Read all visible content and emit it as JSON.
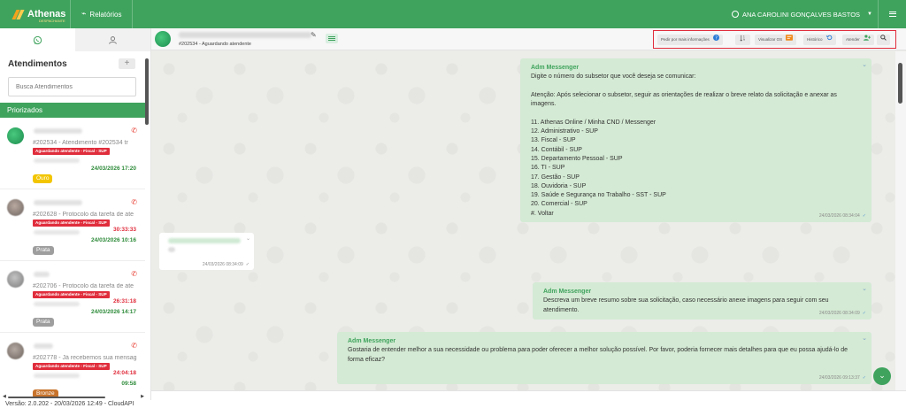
{
  "app": {
    "logo_text": "Athenas",
    "logo_sub": "DESPACHANTE",
    "nav_reports": "Relatórios",
    "user_name": "ANA CAROLINI GONÇALVES BASTOS",
    "colors": {
      "primary": "#3fa35d",
      "danger": "#e02d3c",
      "bubble": "#d4ead4"
    }
  },
  "sidebar": {
    "tabs": [
      {
        "icon": "whatsapp-icon"
      },
      {
        "icon": "user-icon"
      }
    ],
    "title": "Atendimentos",
    "add_label": "+",
    "search_placeholder": "Busca Atendimentos",
    "section_label": "Priorizados",
    "conversations": [
      {
        "subject": "#202534 - Atendimento #202534 tr",
        "badge": "Aguardando atendente - Fiscal - SUP",
        "timer": "",
        "date": "24/03/2026 17:20",
        "tier": "Ouro",
        "tier_color": "#f2c500",
        "avatar": "green"
      },
      {
        "subject": "#202628 - Protocolo da tarefa de ate",
        "badge": "Aguardando atendente - Fiscal - SUP",
        "timer": "30:33:33",
        "date": "24/03/2026 10:16",
        "tier": "Prata",
        "tier_color": "#9e9e9e",
        "avatar": "gray"
      },
      {
        "subject": "#202706 - Protocolo da tarefa de ate",
        "badge": "Aguardando atendente - Fiscal - SUP",
        "timer": "26:31:18",
        "date": "24/03/2026 14:17",
        "tier": "Prata",
        "tier_color": "#9e9e9e",
        "avatar": "gray"
      },
      {
        "subject": "#202778 - Já recebemos sua mensag",
        "badge": "Aguardando atendente - Fiscal - SUP",
        "timer": "24:04:18",
        "date": "09:58",
        "tier": "Bronze",
        "tier_color": "#c8732b",
        "avatar": "gray"
      }
    ],
    "version": "Versão: 2.0.202 - 20/03/2026 12:49 - CloudAPI"
  },
  "chat": {
    "status": "#202534 - Aguardando atendente",
    "actions": [
      {
        "label": "Pedir por mais informações",
        "icon": "question-icon"
      },
      {
        "label": "",
        "icon": "sort-icon"
      },
      {
        "label": "Visualizar OS",
        "icon": "os-icon"
      },
      {
        "label": "Histórico",
        "icon": "history-icon"
      },
      {
        "label": "Atender",
        "icon": "add-user-icon"
      },
      {
        "label": "",
        "icon": "search-icon"
      }
    ],
    "messages": [
      {
        "sender": "Adm Messenger",
        "text": "Digite o número do subsetor que você deseja se comunicar:\n\nAtenção: Após selecionar o subsetor, seguir as orientações de realizar o breve relato da solicitação e anexar as imagens.\n\n11. Athenas Online / Minha CND / Messenger\n12. Administrativo - SUP\n13. Fiscal - SUP\n14. Contábil - SUP\n15. Departamento Pessoal - SUP\n16. TI - SUP\n17. Gestão - SUP\n18. Ouvidoria - SUP\n19. Saúde e Segurança no Trabalho - SST - SUP\n20. Comercial - SUP\n#. Voltar",
        "time": "24/03/2026 08:34:04"
      },
      {
        "incoming_time": "24/03/2026 08:34:09"
      },
      {
        "sender": "Adm Messenger",
        "text": "Descreva um breve resumo sobre sua solicitação, caso necessário anexe imagens para seguir com seu atendimento.",
        "time": "24/03/2026 08:34:09"
      },
      {
        "sender": "Adm Messenger",
        "text": "Gostaria de entender melhor a sua necessidade ou problema para poder oferecer a melhor solução possível. Por favor, poderia fornecer mais detalhes para que eu possa ajudá-lo de forma eficaz?",
        "time": "24/03/2026 09:13:37"
      }
    ]
  }
}
